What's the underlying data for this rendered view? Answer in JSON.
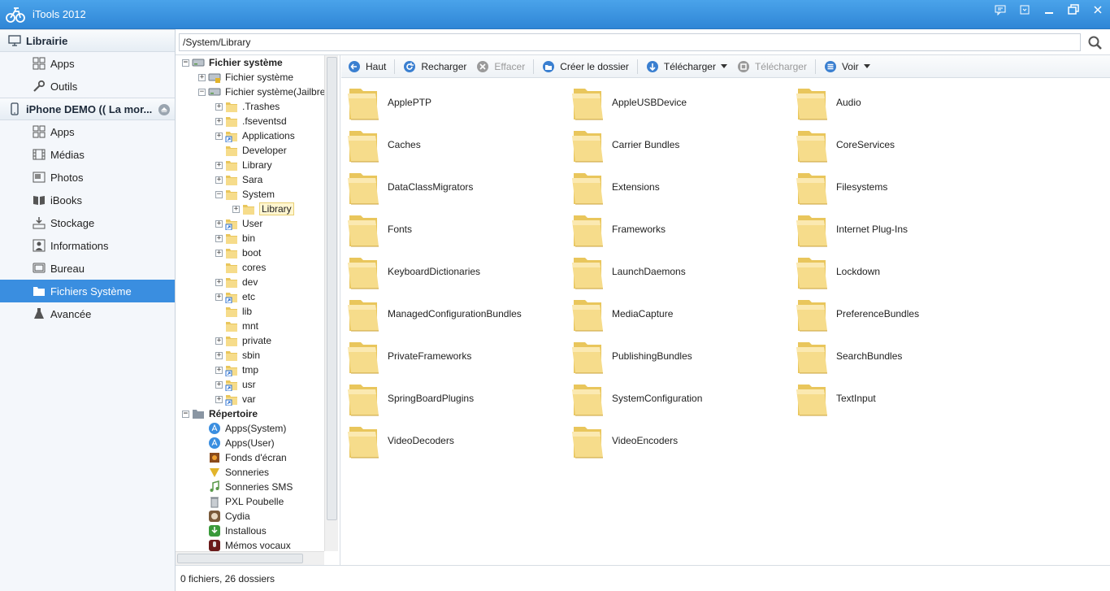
{
  "window": {
    "title": "iTools 2012",
    "controls": [
      "feedback-icon",
      "skin-icon",
      "minimize-icon",
      "restore-icon",
      "close-icon"
    ]
  },
  "sidebar": {
    "library_header": "Librairie",
    "library_items": [
      {
        "label": "Apps",
        "icon": "apps-icon"
      },
      {
        "label": "Outils",
        "icon": "wrench-icon"
      }
    ],
    "device_header": "iPhone DEMO (( La mor...",
    "device_items": [
      {
        "label": "Apps",
        "icon": "apps-icon"
      },
      {
        "label": "Médias",
        "icon": "film-icon"
      },
      {
        "label": "Photos",
        "icon": "photo-icon"
      },
      {
        "label": "iBooks",
        "icon": "book-icon"
      },
      {
        "label": "Stockage",
        "icon": "storage-icon"
      },
      {
        "label": "Informations",
        "icon": "info-icon"
      },
      {
        "label": "Bureau",
        "icon": "desktop-icon"
      },
      {
        "label": "Fichiers Système",
        "icon": "folder-icon",
        "active": true
      },
      {
        "label": "Avancée",
        "icon": "flask-icon"
      }
    ]
  },
  "path": {
    "value": "/System/Library"
  },
  "tree": {
    "root1": "Fichier système",
    "root1_children": [
      {
        "label": "Fichier système"
      },
      {
        "label": "Fichier système(Jailbre"
      }
    ],
    "jail_children": [
      {
        "label": ".Trashes"
      },
      {
        "label": ".fseventsd"
      },
      {
        "label": "Applications"
      },
      {
        "label": "Developer"
      },
      {
        "label": "Library"
      },
      {
        "label": "Sara"
      },
      {
        "label": "System"
      },
      {
        "label": "Library"
      },
      {
        "label": "User"
      },
      {
        "label": "bin"
      },
      {
        "label": "boot"
      },
      {
        "label": "cores"
      },
      {
        "label": "dev"
      },
      {
        "label": "etc"
      },
      {
        "label": "lib"
      },
      {
        "label": "mnt"
      },
      {
        "label": "private"
      },
      {
        "label": "sbin"
      },
      {
        "label": "tmp"
      },
      {
        "label": "usr"
      },
      {
        "label": "var"
      }
    ],
    "root2": "Répertoire",
    "root2_children": [
      {
        "label": "Apps(System)"
      },
      {
        "label": "Apps(User)"
      },
      {
        "label": "Fonds d'écran"
      },
      {
        "label": "Sonneries"
      },
      {
        "label": "Sonneries SMS"
      },
      {
        "label": "PXL Poubelle"
      },
      {
        "label": "Cydia"
      },
      {
        "label": "Installous"
      },
      {
        "label": "Mémos vocaux"
      }
    ]
  },
  "toolbar": {
    "up": "Haut",
    "reload": "Recharger",
    "delete": "Effacer",
    "new_folder": "Créer le dossier",
    "upload": "Télécharger",
    "download": "Télécharger",
    "view": "Voir"
  },
  "folders": [
    "ApplePTP",
    "AppleUSBDevice",
    "Audio",
    "Caches",
    "Carrier Bundles",
    "CoreServices",
    "DataClassMigrators",
    "Extensions",
    "Filesystems",
    "Fonts",
    "Frameworks",
    "Internet Plug-Ins",
    "KeyboardDictionaries",
    "LaunchDaemons",
    "Lockdown",
    "ManagedConfigurationBundles",
    "MediaCapture",
    "PreferenceBundles",
    "PrivateFrameworks",
    "PublishingBundles",
    "SearchBundles",
    "SpringBoardPlugins",
    "SystemConfiguration",
    "TextInput",
    "VideoDecoders",
    "VideoEncoders"
  ],
  "status": {
    "text": "0 fichiers, 26 dossiers"
  },
  "colors": {
    "titlebar": "#3a95e2",
    "selection": "#3a8ee0",
    "folder": "#f3d77f"
  }
}
